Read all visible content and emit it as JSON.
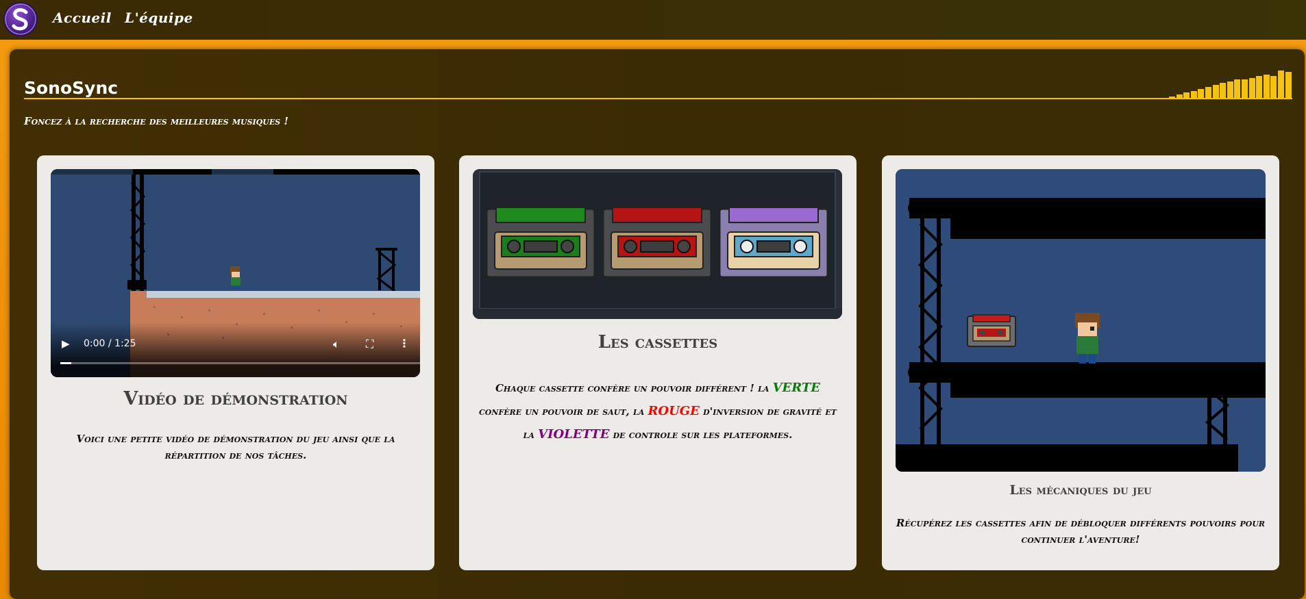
{
  "nav": {
    "links": [
      "Accueil",
      "L'équipe"
    ]
  },
  "header": {
    "title": "SonoSync",
    "subtitle": "Foncez à la recherche des meilleures musiques !",
    "equalizer_levels": [
      0.07,
      0.12,
      0.17,
      0.22,
      0.27,
      0.32,
      0.37,
      0.42,
      0.47,
      0.52,
      0.52,
      0.55,
      0.6,
      0.65,
      0.6,
      0.75,
      0.72
    ]
  },
  "cards": [
    {
      "title": "Vidéo de démonstration",
      "description": "Voici une petite vidéo de démonstration du jeu ainsi que la répartition de nos tâches.",
      "video": {
        "time": "0:00 / 1:25",
        "progress": 0.03
      }
    },
    {
      "title": "Les cassettes",
      "text_parts": [
        "Chaque cassette confère un pouvoir différent ! la ",
        "VERTE",
        " confère un pouvoir de saut, la ",
        "ROUGE",
        " d'inversion de gravité et la ",
        "VIOLETTE",
        " de controle sur les plateformes."
      ]
    },
    {
      "title": "Les mécaniques du jeu",
      "description": "Récupérez les cassettes afin de débloquer différents pouvoirs pour continuer l'aventure!"
    }
  ],
  "colors": {
    "accent": "#f5c211",
    "green_word": "#0a7a0a",
    "red_word": "#ff0000",
    "violet_word": "#800080"
  }
}
